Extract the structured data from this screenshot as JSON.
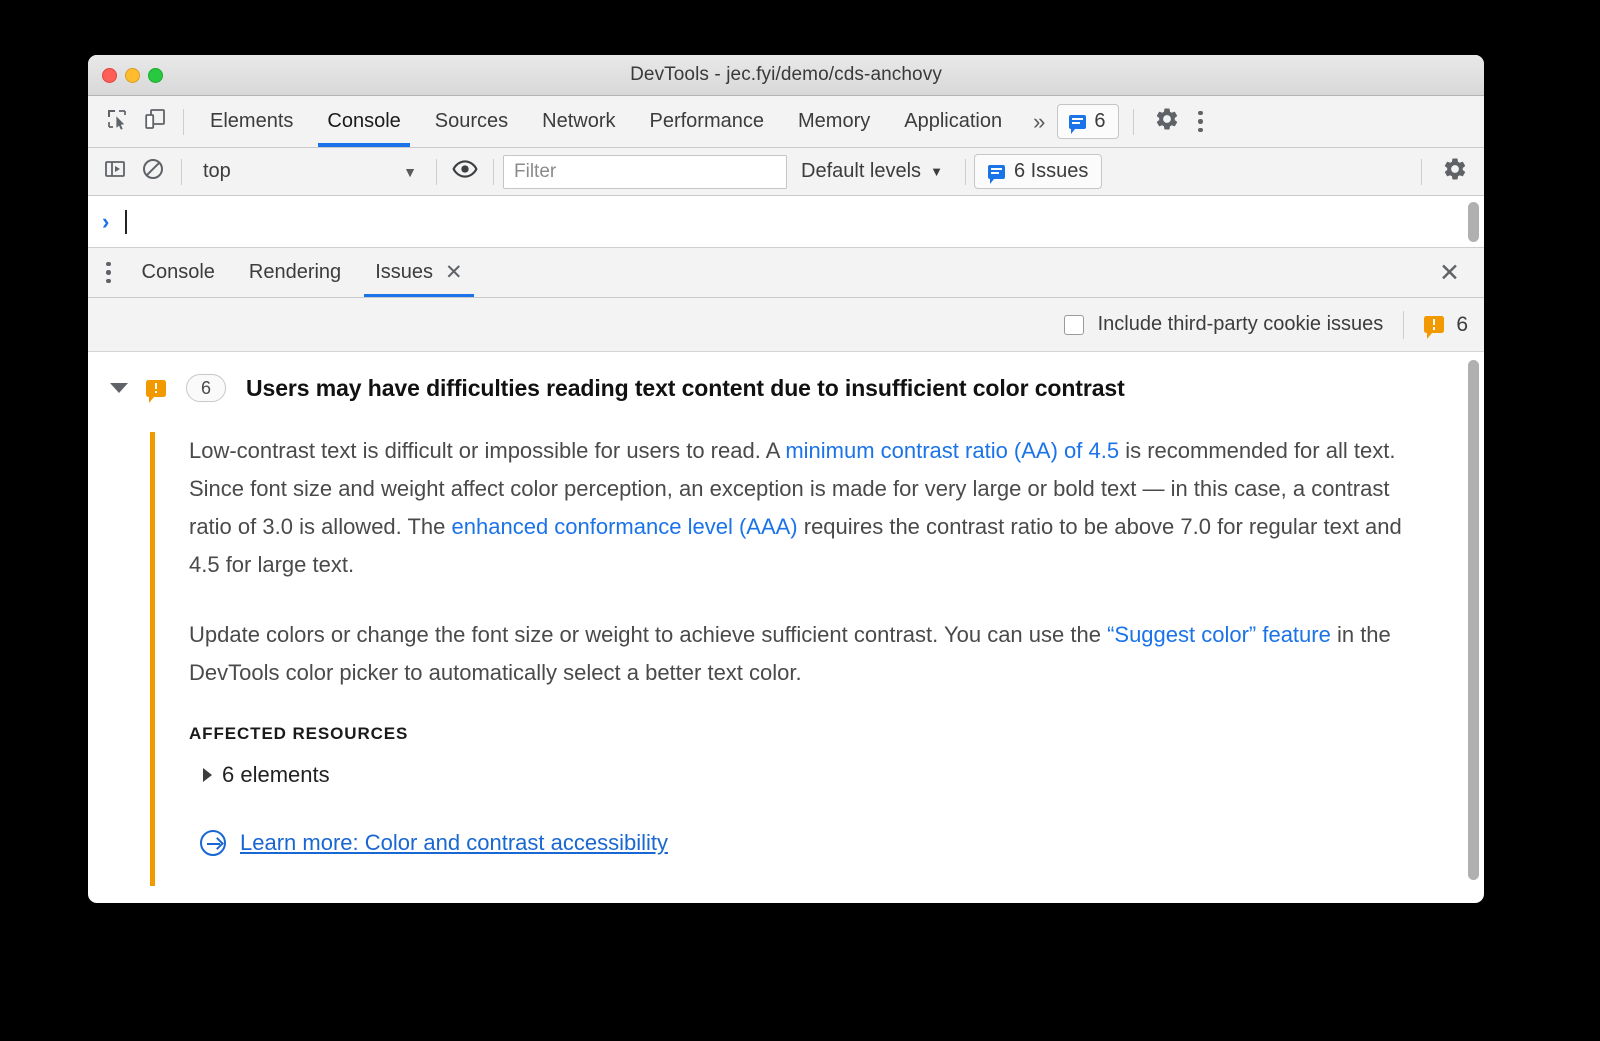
{
  "window": {
    "title": "DevTools - jec.fyi/demo/cds-anchovy",
    "traffic_lights": [
      "close",
      "minimize",
      "zoom"
    ]
  },
  "panel_toolbar": {
    "inspect_icon": "inspect-element-icon",
    "device_icon": "device-toolbar-icon",
    "tabs": [
      {
        "label": "Elements",
        "active": false
      },
      {
        "label": "Console",
        "active": true
      },
      {
        "label": "Sources",
        "active": false
      },
      {
        "label": "Network",
        "active": false
      },
      {
        "label": "Performance",
        "active": false
      },
      {
        "label": "Memory",
        "active": false
      },
      {
        "label": "Application",
        "active": false
      }
    ],
    "more_tabs_label": "»",
    "issues_badge_count": "6",
    "settings_icon": "gear-icon",
    "menu_icon": "kebab-menu-icon"
  },
  "console_toolbar": {
    "execute_icon": "execution-context-icon",
    "clear_icon": "clear-console-icon",
    "context_value": "top",
    "context_caret": "▼",
    "eye_icon": "live-expression-eye-icon",
    "filter_placeholder": "Filter",
    "filter_value": "",
    "levels_label": "Default levels",
    "levels_caret": "▼",
    "issues_button_label": "6 Issues",
    "settings_icon": "gear-icon"
  },
  "prompt": {
    "arrow": "›",
    "value": ""
  },
  "drawer": {
    "menu_icon": "kebab-menu-icon",
    "tabs": [
      {
        "label": "Console",
        "active": false,
        "closable": false
      },
      {
        "label": "Rendering",
        "active": false,
        "closable": false
      },
      {
        "label": "Issues",
        "active": true,
        "closable": true
      }
    ],
    "tab_close_glyph": "✕",
    "close_glyph": "✕"
  },
  "issues_options": {
    "third_party_label": "Include third-party cookie issues",
    "third_party_checked": false,
    "warning_icon": "issue-warning-bubble-icon",
    "warning_count": "6"
  },
  "issue": {
    "expanded": true,
    "icon": "issue-warning-bubble-icon",
    "count_badge": "6",
    "title": "Users may have difficulties reading text content due to insufficient color contrast",
    "paragraph_1": [
      {
        "t": "Low-contrast text is difficult or impossible for users to read. A ",
        "link": false
      },
      {
        "t": "minimum contrast ratio (AA) of 4.5",
        "link": true
      },
      {
        "t": " is recommended for all text. Since font size and weight affect color perception, an exception is made for very large or bold text — in this case, a contrast ratio of 3.0 is allowed. The ",
        "link": false
      },
      {
        "t": "enhanced conformance level (AAA)",
        "link": true
      },
      {
        "t": " requires the contrast ratio to be above 7.0 for regular text and 4.5 for large text.",
        "link": false
      }
    ],
    "paragraph_2": [
      {
        "t": "Update colors or change the font size or weight to achieve sufficient contrast. You can use the ",
        "link": false
      },
      {
        "t": "“Suggest color” feature",
        "link": true
      },
      {
        "t": " in the DevTools color picker to automatically select a better text color.",
        "link": false
      }
    ],
    "affected_resources_label": "AFFECTED RESOURCES",
    "affected_resources_value": "6 elements",
    "learn_more_label": "Learn more: Color and contrast accessibility",
    "learn_more_icon": "circle-arrow-right-icon",
    "accent_color": "#f29900"
  },
  "colors": {
    "link": "#1a73e8",
    "issue_orange": "#f29900",
    "tab_active_underline": "#1a73e8",
    "window_bg": "#ffffff",
    "toolbar_bg": "#f3f3f3",
    "page_backdrop": "#000000"
  }
}
